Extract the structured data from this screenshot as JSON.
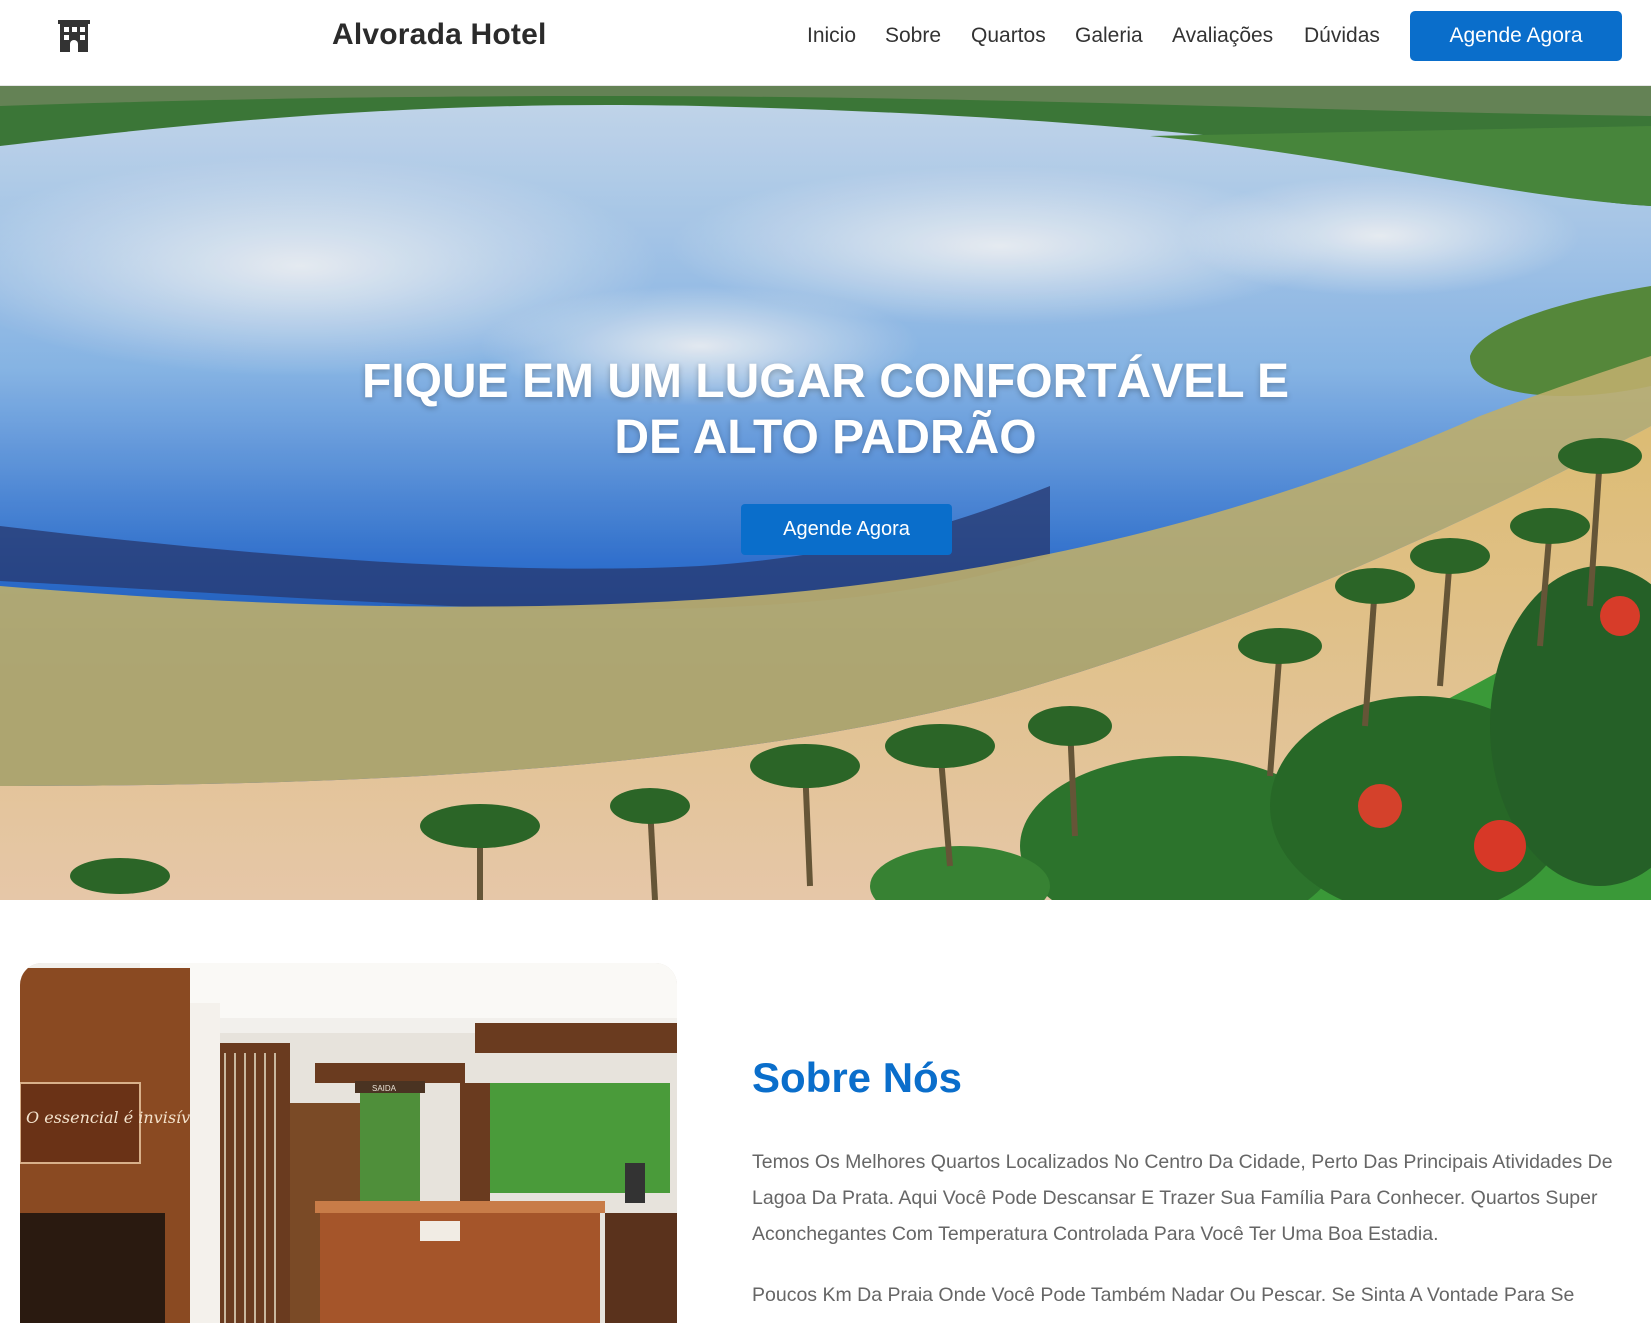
{
  "header": {
    "brand": "Alvorada Hotel",
    "logo_icon": "hotel-building-icon",
    "nav": [
      {
        "label": "Inicio"
      },
      {
        "label": "Sobre"
      },
      {
        "label": "Quartos"
      },
      {
        "label": "Galeria"
      },
      {
        "label": "Avaliações"
      },
      {
        "label": "Dúvidas"
      }
    ],
    "cta_label": "Agende Agora"
  },
  "hero": {
    "title_line1": "FIQUE EM UM LUGAR CONFORTÁVEL E",
    "title_line2": "DE ALTO PADRÃO",
    "cta_label": "Agende Agora"
  },
  "about": {
    "title": "Sobre Nós",
    "paragraph1": "Temos Os Melhores Quartos Localizados No Centro Da Cidade, Perto Das Principais Atividades De Lagoa Da Prata. Aqui Você Pode Descansar E Trazer Sua Família Para Conhecer. Quartos Super Aconchegantes Com Temperatura Controlada Para Você Ter Uma Boa Estadia.",
    "paragraph2": "Poucos Km Da Praia Onde Você Pode Também Nadar Ou Pescar. Se Sinta A Vontade Para Se",
    "photo_sign_text": "O essencial é invisível aos olhos",
    "photo_door_sign": "SAIDA"
  },
  "colors": {
    "accent": "#0a6ecb",
    "heading": "#2b2b2b",
    "body_text": "#666666"
  }
}
